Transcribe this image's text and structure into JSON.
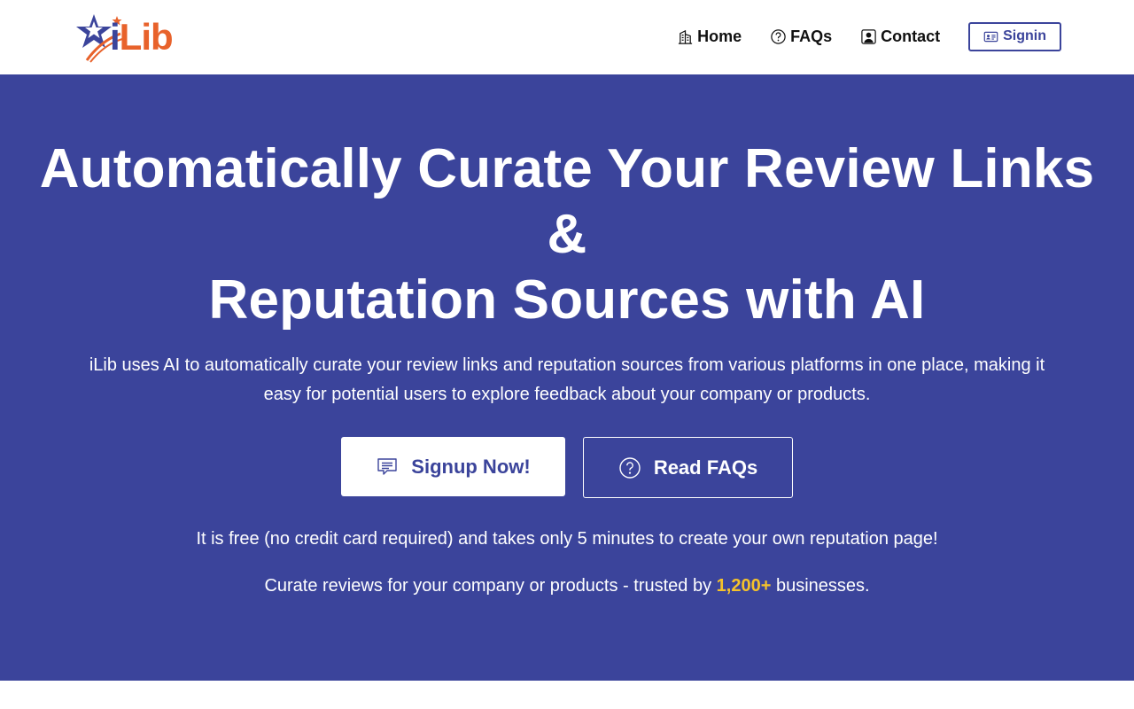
{
  "brand": {
    "logo_i": "i",
    "logo_lib": "Lib",
    "primary_color": "#3b449b",
    "accent_color": "#e8622b",
    "highlight_color": "#f5c22b"
  },
  "nav": {
    "items": [
      {
        "label": "Home",
        "icon": "building-icon"
      },
      {
        "label": "FAQs",
        "icon": "question-circle-icon"
      },
      {
        "label": "Contact",
        "icon": "person-square-icon"
      }
    ],
    "signin_label": "Signin",
    "signin_icon": "id-card-icon"
  },
  "hero": {
    "headline_line1": "Automatically Curate Your Review Links",
    "headline_line2": "&",
    "headline_line3": "Reputation Sources with AI",
    "subtext": "iLib uses AI to automatically curate your review links and reputation sources from various platforms in one place, making it easy for potential users to explore feedback about your company or products.",
    "primary_button_label": "Signup Now!",
    "primary_button_icon": "chat-lines-icon",
    "secondary_button_label": "Read FAQs",
    "secondary_button_icon": "question-circle-icon",
    "free_note": "It is free (no credit card required) and takes only 5 minutes to create your own reputation page!",
    "trusted_prefix": "Curate reviews for your company or products - trusted by ",
    "trusted_count": "1,200+",
    "trusted_suffix": " businesses."
  }
}
